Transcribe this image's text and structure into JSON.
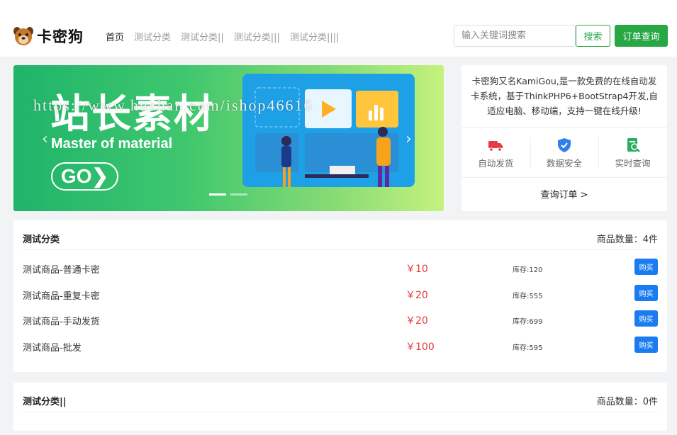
{
  "header": {
    "logo_text": "卡密狗",
    "nav": [
      {
        "label": "首页"
      },
      {
        "label": "测试分类"
      },
      {
        "label": "测试分类||"
      },
      {
        "label": "测试分类|||"
      },
      {
        "label": "测试分类||||"
      }
    ],
    "search_placeholder": "输入关键词搜索",
    "search_label": "搜索",
    "order_label": "订单查询"
  },
  "banner": {
    "title": "站长素材",
    "subtitle": "Master of material",
    "go": "GO❯",
    "watermark": "https://www.huzhan.com/ishop46616",
    "prev": "‹",
    "next": "›"
  },
  "info": {
    "description": "卡密狗又名KamiGou,是一款免费的在线自动发卡系统，基于ThinkPHP6+BootStrap4开发,自适应电脑、移动端，支持一键在线升级!",
    "features": [
      {
        "label": "自动发货",
        "icon": "truck-icon",
        "color": "#e63946"
      },
      {
        "label": "数据安全",
        "icon": "shield-icon",
        "color": "#2f80ed"
      },
      {
        "label": "实时查询",
        "icon": "search-doc-icon",
        "color": "#27ae60"
      }
    ],
    "link": "查询订单 >"
  },
  "categories": [
    {
      "title": "测试分类",
      "count": "商品数量：4件",
      "products": [
        {
          "name": "测试商品-普通卡密",
          "price": "￥10",
          "stock": "库存:120",
          "buy": "购买"
        },
        {
          "name": "测试商品-重复卡密",
          "price": "￥20",
          "stock": "库存:555",
          "buy": "购买"
        },
        {
          "name": "测试商品-手动发货",
          "price": "￥20",
          "stock": "库存:699",
          "buy": "购买"
        },
        {
          "name": "测试商品-批发",
          "price": "￥100",
          "stock": "库存:595",
          "buy": "购买"
        }
      ]
    },
    {
      "title": "测试分类||",
      "count": "商品数量：0件",
      "products": []
    }
  ],
  "colors": {
    "primary": "#28a745",
    "price": "#e4393c",
    "buy": "#1a7cf0"
  }
}
